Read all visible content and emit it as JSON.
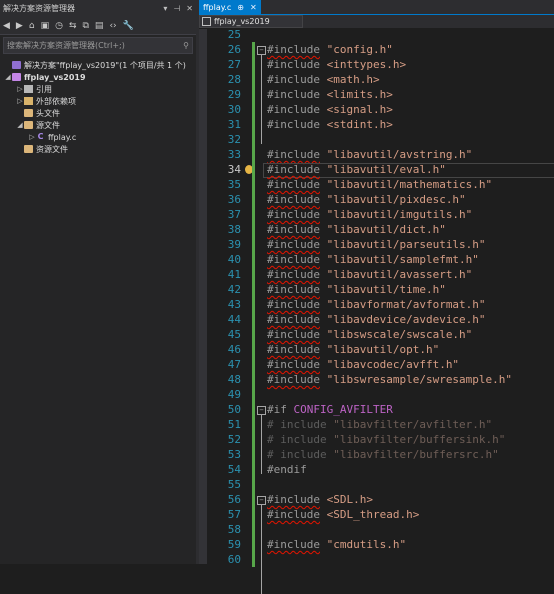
{
  "solution_explorer": {
    "title": "解决方案资源管理器",
    "title_buttons": [
      "▾",
      "⊣",
      "✕"
    ],
    "toolbar_icons": [
      "back-icon",
      "forward-icon",
      "home-icon",
      "switch-views-icon",
      "pending-changes-icon",
      "sync-icon",
      "collapse-all-icon",
      "show-all-files-icon",
      "view-code-icon",
      "properties-icon"
    ],
    "toolbar_glyphs": [
      "◀",
      "▶",
      "⌂",
      "▣",
      "◷",
      "⇆",
      "⧉",
      "▤",
      "‹›",
      "🔧"
    ],
    "search_placeholder": "搜索解决方案资源管理器(Ctrl+;)",
    "search_icon": "⚲",
    "tree": [
      {
        "label": "解决方案\"ffplay_vs2019\"(1 个项目/共 1 个)",
        "level": 0,
        "arrow": "",
        "icon": "sln",
        "bold": false
      },
      {
        "label": "ffplay_vs2019",
        "level": 0,
        "arrow": "◢",
        "icon": "proj",
        "bold": true
      },
      {
        "label": "引用",
        "level": 1,
        "arrow": "▷",
        "icon": "ref",
        "bold": false
      },
      {
        "label": "外部依赖项",
        "level": 1,
        "arrow": "▷",
        "icon": "ext",
        "bold": false
      },
      {
        "label": "头文件",
        "level": 1,
        "arrow": "",
        "icon": "folder",
        "bold": false
      },
      {
        "label": "源文件",
        "level": 1,
        "arrow": "◢",
        "icon": "folder",
        "bold": false
      },
      {
        "label": "ffplay.c",
        "level": 2,
        "arrow": "▷",
        "icon": "cfile",
        "bold": false
      },
      {
        "label": "资源文件",
        "level": 1,
        "arrow": "",
        "icon": "folder",
        "bold": false
      }
    ]
  },
  "editor": {
    "tab_label": "ffplay.c",
    "tab_pin": "⊕",
    "tab_close": "✕",
    "project_dropdown": "ffplay_vs2019",
    "current_line": "34",
    "lines": [
      {
        "n": "25",
        "parts": []
      },
      {
        "n": "26",
        "fold": "⊟",
        "parts": [
          {
            "t": "#include",
            "c": "kw sq"
          },
          {
            "t": " \"config.h\"",
            "c": "str"
          }
        ]
      },
      {
        "n": "27",
        "parts": [
          {
            "t": "#include",
            "c": "kw"
          },
          {
            "t": " <inttypes.h>",
            "c": "str"
          }
        ]
      },
      {
        "n": "28",
        "parts": [
          {
            "t": "#include",
            "c": "kw"
          },
          {
            "t": " <math.h>",
            "c": "str"
          }
        ]
      },
      {
        "n": "29",
        "parts": [
          {
            "t": "#include",
            "c": "kw"
          },
          {
            "t": " <limits.h>",
            "c": "str"
          }
        ]
      },
      {
        "n": "30",
        "parts": [
          {
            "t": "#include",
            "c": "kw"
          },
          {
            "t": " <signal.h>",
            "c": "str"
          }
        ]
      },
      {
        "n": "31",
        "parts": [
          {
            "t": "#include",
            "c": "kw"
          },
          {
            "t": " <stdint.h>",
            "c": "str"
          }
        ]
      },
      {
        "n": "32",
        "parts": []
      },
      {
        "n": "33",
        "parts": [
          {
            "t": "#include",
            "c": "kw sq"
          },
          {
            "t": " \"libavutil/avstring.h\"",
            "c": "str"
          }
        ]
      },
      {
        "n": "34",
        "parts": [
          {
            "t": "#include",
            "c": "kw sq"
          },
          {
            "t": " \"libavutil/eval.h\"",
            "c": "str"
          }
        ]
      },
      {
        "n": "35",
        "parts": [
          {
            "t": "#include",
            "c": "kw sq"
          },
          {
            "t": " \"libavutil/mathematics.h\"",
            "c": "str"
          }
        ]
      },
      {
        "n": "36",
        "parts": [
          {
            "t": "#include",
            "c": "kw sq"
          },
          {
            "t": " \"libavutil/pixdesc.h\"",
            "c": "str"
          }
        ]
      },
      {
        "n": "37",
        "parts": [
          {
            "t": "#include",
            "c": "kw sq"
          },
          {
            "t": " \"libavutil/imgutils.h\"",
            "c": "str"
          }
        ]
      },
      {
        "n": "38",
        "parts": [
          {
            "t": "#include",
            "c": "kw sq"
          },
          {
            "t": " \"libavutil/dict.h\"",
            "c": "str"
          }
        ]
      },
      {
        "n": "39",
        "parts": [
          {
            "t": "#include",
            "c": "kw sq"
          },
          {
            "t": " \"libavutil/parseutils.h\"",
            "c": "str"
          }
        ]
      },
      {
        "n": "40",
        "parts": [
          {
            "t": "#include",
            "c": "kw sq"
          },
          {
            "t": " \"libavutil/samplefmt.h\"",
            "c": "str"
          }
        ]
      },
      {
        "n": "41",
        "parts": [
          {
            "t": "#include",
            "c": "kw sq"
          },
          {
            "t": " \"libavutil/avassert.h\"",
            "c": "str"
          }
        ]
      },
      {
        "n": "42",
        "parts": [
          {
            "t": "#include",
            "c": "kw sq"
          },
          {
            "t": " \"libavutil/time.h\"",
            "c": "str"
          }
        ]
      },
      {
        "n": "43",
        "parts": [
          {
            "t": "#include",
            "c": "kw sq"
          },
          {
            "t": " \"libavformat/avformat.h\"",
            "c": "str"
          }
        ]
      },
      {
        "n": "44",
        "parts": [
          {
            "t": "#include",
            "c": "kw sq"
          },
          {
            "t": " \"libavdevice/avdevice.h\"",
            "c": "str"
          }
        ]
      },
      {
        "n": "45",
        "parts": [
          {
            "t": "#include",
            "c": "kw sq"
          },
          {
            "t": " \"libswscale/swscale.h\"",
            "c": "str"
          }
        ]
      },
      {
        "n": "46",
        "parts": [
          {
            "t": "#include",
            "c": "kw sq"
          },
          {
            "t": " \"libavutil/opt.h\"",
            "c": "str"
          }
        ]
      },
      {
        "n": "47",
        "parts": [
          {
            "t": "#include",
            "c": "kw sq"
          },
          {
            "t": " \"libavcodec/avfft.h\"",
            "c": "str"
          }
        ]
      },
      {
        "n": "48",
        "parts": [
          {
            "t": "#include",
            "c": "kw sq"
          },
          {
            "t": " \"libswresample/swresample.h\"",
            "c": "str"
          }
        ]
      },
      {
        "n": "49",
        "parts": []
      },
      {
        "n": "50",
        "fold": "⊟",
        "parts": [
          {
            "t": "#if",
            "c": "kw"
          },
          {
            "t": " CONFIG_AVFILTER",
            "c": "pp"
          }
        ]
      },
      {
        "n": "51",
        "parts": [
          {
            "t": "# include",
            "c": "dim"
          },
          {
            "t": " \"libavfilter/avfilter.h\"",
            "c": "dimstr"
          }
        ]
      },
      {
        "n": "52",
        "parts": [
          {
            "t": "# include",
            "c": "dim"
          },
          {
            "t": " \"libavfilter/buffersink.h\"",
            "c": "dimstr"
          }
        ]
      },
      {
        "n": "53",
        "parts": [
          {
            "t": "# include",
            "c": "dim"
          },
          {
            "t": " \"libavfilter/buffersrc.h\"",
            "c": "dimstr"
          }
        ]
      },
      {
        "n": "54",
        "parts": [
          {
            "t": "#endif",
            "c": "kw"
          }
        ]
      },
      {
        "n": "55",
        "parts": []
      },
      {
        "n": "56",
        "fold": "⊟",
        "parts": [
          {
            "t": "#include",
            "c": "kw sq"
          },
          {
            "t": " <SDL.h>",
            "c": "str"
          }
        ]
      },
      {
        "n": "57",
        "parts": [
          {
            "t": "#include",
            "c": "kw sq"
          },
          {
            "t": " <SDL_thread.h>",
            "c": "str"
          }
        ]
      },
      {
        "n": "58",
        "parts": []
      },
      {
        "n": "59",
        "parts": [
          {
            "t": "#include",
            "c": "kw sq"
          },
          {
            "t": " \"cmdutils.h\"",
            "c": "str"
          }
        ]
      },
      {
        "n": "60",
        "parts": []
      }
    ]
  }
}
